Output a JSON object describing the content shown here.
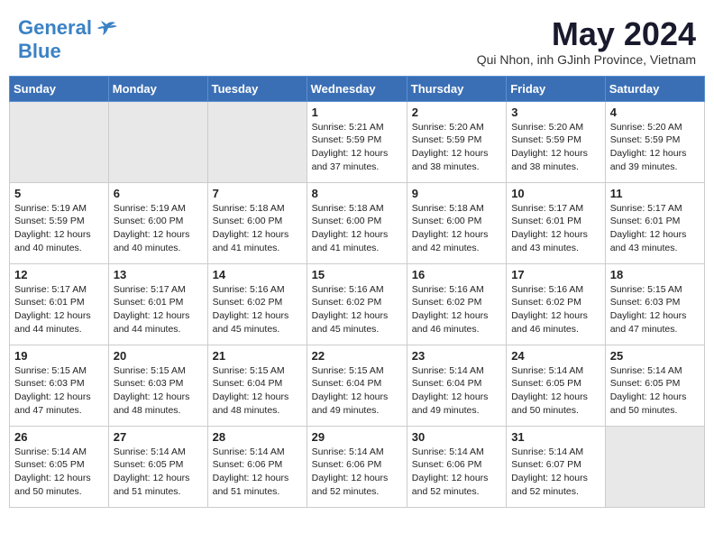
{
  "header": {
    "logo_line1": "General",
    "logo_line2": "Blue",
    "month": "May 2024",
    "location": "Qui Nhon, inh GJinh Province, Vietnam"
  },
  "weekdays": [
    "Sunday",
    "Monday",
    "Tuesday",
    "Wednesday",
    "Thursday",
    "Friday",
    "Saturday"
  ],
  "weeks": [
    [
      {
        "day": "",
        "info": "",
        "empty": true
      },
      {
        "day": "",
        "info": "",
        "empty": true
      },
      {
        "day": "",
        "info": "",
        "empty": true
      },
      {
        "day": "1",
        "info": "Sunrise: 5:21 AM\nSunset: 5:59 PM\nDaylight: 12 hours\nand 37 minutes."
      },
      {
        "day": "2",
        "info": "Sunrise: 5:20 AM\nSunset: 5:59 PM\nDaylight: 12 hours\nand 38 minutes."
      },
      {
        "day": "3",
        "info": "Sunrise: 5:20 AM\nSunset: 5:59 PM\nDaylight: 12 hours\nand 38 minutes."
      },
      {
        "day": "4",
        "info": "Sunrise: 5:20 AM\nSunset: 5:59 PM\nDaylight: 12 hours\nand 39 minutes."
      }
    ],
    [
      {
        "day": "5",
        "info": "Sunrise: 5:19 AM\nSunset: 5:59 PM\nDaylight: 12 hours\nand 40 minutes."
      },
      {
        "day": "6",
        "info": "Sunrise: 5:19 AM\nSunset: 6:00 PM\nDaylight: 12 hours\nand 40 minutes."
      },
      {
        "day": "7",
        "info": "Sunrise: 5:18 AM\nSunset: 6:00 PM\nDaylight: 12 hours\nand 41 minutes."
      },
      {
        "day": "8",
        "info": "Sunrise: 5:18 AM\nSunset: 6:00 PM\nDaylight: 12 hours\nand 41 minutes."
      },
      {
        "day": "9",
        "info": "Sunrise: 5:18 AM\nSunset: 6:00 PM\nDaylight: 12 hours\nand 42 minutes."
      },
      {
        "day": "10",
        "info": "Sunrise: 5:17 AM\nSunset: 6:01 PM\nDaylight: 12 hours\nand 43 minutes."
      },
      {
        "day": "11",
        "info": "Sunrise: 5:17 AM\nSunset: 6:01 PM\nDaylight: 12 hours\nand 43 minutes."
      }
    ],
    [
      {
        "day": "12",
        "info": "Sunrise: 5:17 AM\nSunset: 6:01 PM\nDaylight: 12 hours\nand 44 minutes."
      },
      {
        "day": "13",
        "info": "Sunrise: 5:17 AM\nSunset: 6:01 PM\nDaylight: 12 hours\nand 44 minutes."
      },
      {
        "day": "14",
        "info": "Sunrise: 5:16 AM\nSunset: 6:02 PM\nDaylight: 12 hours\nand 45 minutes."
      },
      {
        "day": "15",
        "info": "Sunrise: 5:16 AM\nSunset: 6:02 PM\nDaylight: 12 hours\nand 45 minutes."
      },
      {
        "day": "16",
        "info": "Sunrise: 5:16 AM\nSunset: 6:02 PM\nDaylight: 12 hours\nand 46 minutes."
      },
      {
        "day": "17",
        "info": "Sunrise: 5:16 AM\nSunset: 6:02 PM\nDaylight: 12 hours\nand 46 minutes."
      },
      {
        "day": "18",
        "info": "Sunrise: 5:15 AM\nSunset: 6:03 PM\nDaylight: 12 hours\nand 47 minutes."
      }
    ],
    [
      {
        "day": "19",
        "info": "Sunrise: 5:15 AM\nSunset: 6:03 PM\nDaylight: 12 hours\nand 47 minutes."
      },
      {
        "day": "20",
        "info": "Sunrise: 5:15 AM\nSunset: 6:03 PM\nDaylight: 12 hours\nand 48 minutes."
      },
      {
        "day": "21",
        "info": "Sunrise: 5:15 AM\nSunset: 6:04 PM\nDaylight: 12 hours\nand 48 minutes."
      },
      {
        "day": "22",
        "info": "Sunrise: 5:15 AM\nSunset: 6:04 PM\nDaylight: 12 hours\nand 49 minutes."
      },
      {
        "day": "23",
        "info": "Sunrise: 5:14 AM\nSunset: 6:04 PM\nDaylight: 12 hours\nand 49 minutes."
      },
      {
        "day": "24",
        "info": "Sunrise: 5:14 AM\nSunset: 6:05 PM\nDaylight: 12 hours\nand 50 minutes."
      },
      {
        "day": "25",
        "info": "Sunrise: 5:14 AM\nSunset: 6:05 PM\nDaylight: 12 hours\nand 50 minutes."
      }
    ],
    [
      {
        "day": "26",
        "info": "Sunrise: 5:14 AM\nSunset: 6:05 PM\nDaylight: 12 hours\nand 50 minutes."
      },
      {
        "day": "27",
        "info": "Sunrise: 5:14 AM\nSunset: 6:05 PM\nDaylight: 12 hours\nand 51 minutes."
      },
      {
        "day": "28",
        "info": "Sunrise: 5:14 AM\nSunset: 6:06 PM\nDaylight: 12 hours\nand 51 minutes."
      },
      {
        "day": "29",
        "info": "Sunrise: 5:14 AM\nSunset: 6:06 PM\nDaylight: 12 hours\nand 52 minutes."
      },
      {
        "day": "30",
        "info": "Sunrise: 5:14 AM\nSunset: 6:06 PM\nDaylight: 12 hours\nand 52 minutes."
      },
      {
        "day": "31",
        "info": "Sunrise: 5:14 AM\nSunset: 6:07 PM\nDaylight: 12 hours\nand 52 minutes."
      },
      {
        "day": "",
        "info": "",
        "empty": true
      }
    ]
  ]
}
